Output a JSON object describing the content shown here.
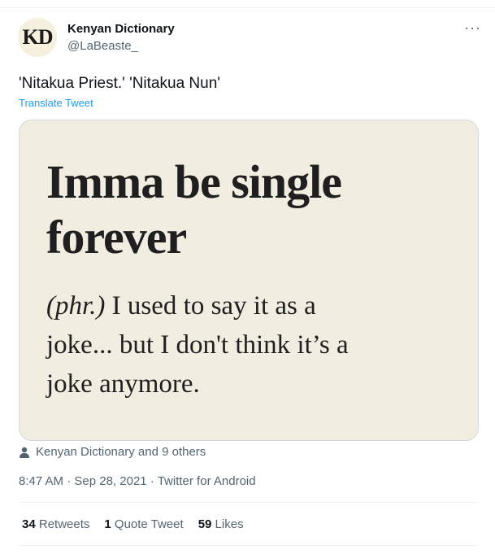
{
  "author": {
    "avatar_text": "KD",
    "display_name": "Kenyan Dictionary",
    "handle": "@LaBeaste_"
  },
  "more_menu": "···",
  "tweet": {
    "text": "'Nitakua Priest.' 'Nitakua Nun'",
    "translate": "Translate Tweet"
  },
  "media": {
    "headword_line1": "Imma be single",
    "headword_line2": "forever",
    "part_of_speech": "(phr.)",
    "definition_line1": " I used to say it as a",
    "definition_line2": "joke... but I don't think it’s a",
    "definition_line3": "joke anymore."
  },
  "liked_by": "Kenyan Dictionary and 9 others",
  "meta": {
    "time": "8:47 AM",
    "date": "Sep 28, 2021",
    "source": "Twitter for Android",
    "separator": "·"
  },
  "stats": {
    "retweets_count": "34",
    "retweets_label": "Retweets",
    "quotes_count": "1",
    "quotes_label": "Quote Tweet",
    "likes_count": "59",
    "likes_label": "Likes"
  },
  "colors": {
    "accent": "#1d9bf0",
    "secondary_text": "#536471",
    "media_background": "#f1ede1"
  }
}
